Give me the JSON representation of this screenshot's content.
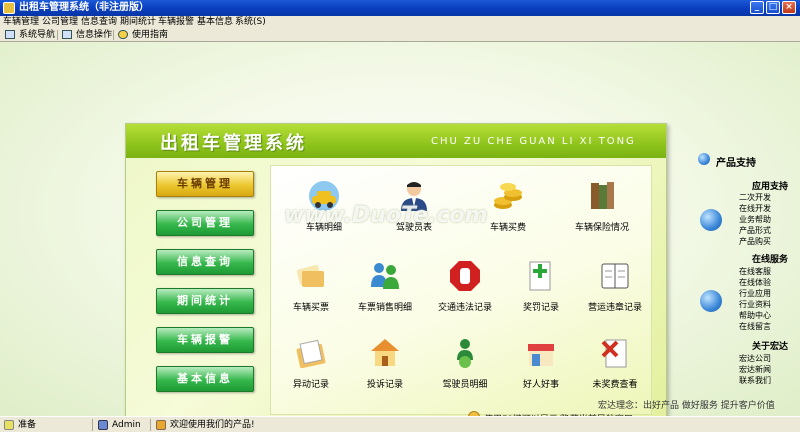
{
  "window": {
    "title": "出租车管理系统（非注册版）"
  },
  "menu": [
    "车辆管理",
    "公司管理",
    "信息查询",
    "期间统计",
    "车辆报警",
    "基本信息",
    "系统(S)"
  ],
  "toolbar": [
    {
      "label": "系统导航",
      "icon": "nav-icon"
    },
    {
      "label": "信息操作",
      "icon": "form-icon"
    },
    {
      "label": "使用指南",
      "icon": "help-icon"
    }
  ],
  "panel": {
    "title": "出租车管理系统",
    "subtitle": "CHU ZU CHE GUAN LI XI TONG",
    "nav": [
      "车辆管理",
      "公司管理",
      "信息查询",
      "期间统计",
      "车辆报警",
      "基本信息"
    ],
    "active_nav": "车辆管理",
    "tiles": [
      {
        "label": "车辆明细",
        "icon": "taxi-icon"
      },
      {
        "label": "驾驶员表",
        "icon": "driver-icon"
      },
      {
        "label": "车辆买费",
        "icon": "coins-icon"
      },
      {
        "label": "车辆保险情况",
        "icon": "books-icon"
      },
      {
        "label": "车辆买票",
        "icon": "tickets-icon"
      },
      {
        "label": "车票销售明细",
        "icon": "users-icon"
      },
      {
        "label": "交通违法记录",
        "icon": "stop-hand-icon"
      },
      {
        "label": "奖罚记录",
        "icon": "add-document-icon"
      },
      {
        "label": "营运违章记录",
        "icon": "notebook-icon"
      },
      {
        "label": "异动记录",
        "icon": "clipboard-icon"
      },
      {
        "label": "投诉记录",
        "icon": "house-icon"
      },
      {
        "label": "驾驶员明细",
        "icon": "person-globe-icon"
      },
      {
        "label": "好人好事",
        "icon": "shop-icon"
      },
      {
        "label": "未奖费查看",
        "icon": "delete-document-icon"
      }
    ],
    "hint": "使用F8键可以显示/隐藏当前导航窗口",
    "watermark": "www.DuoTe.com"
  },
  "sidebar": {
    "heading": "产品支持",
    "sections": [
      {
        "title": "应用支持",
        "items": [
          "二次开发",
          "在线开发",
          "业务帮助",
          "产品形式",
          "产品购买"
        ]
      },
      {
        "title": "在线服务",
        "items": [
          "在线客服",
          "在线体验",
          "行业应用",
          "行业资料",
          "帮助中心",
          "在线留言"
        ]
      },
      {
        "title": "关于宏达",
        "items": [
          "宏达公司",
          "宏达新闻",
          "联系我们"
        ]
      }
    ]
  },
  "motto": "宏达理念：出好产品  做好服务  提升客户价值",
  "status": {
    "ready": "准备",
    "user": "Admin",
    "welcome": "欢迎使用我们的产品!"
  },
  "colors": {
    "header_green": "#8fc41c",
    "nav_green": "#36b84c",
    "nav_active": "#ecc830",
    "titlebar_blue": "#0a3fbf"
  }
}
